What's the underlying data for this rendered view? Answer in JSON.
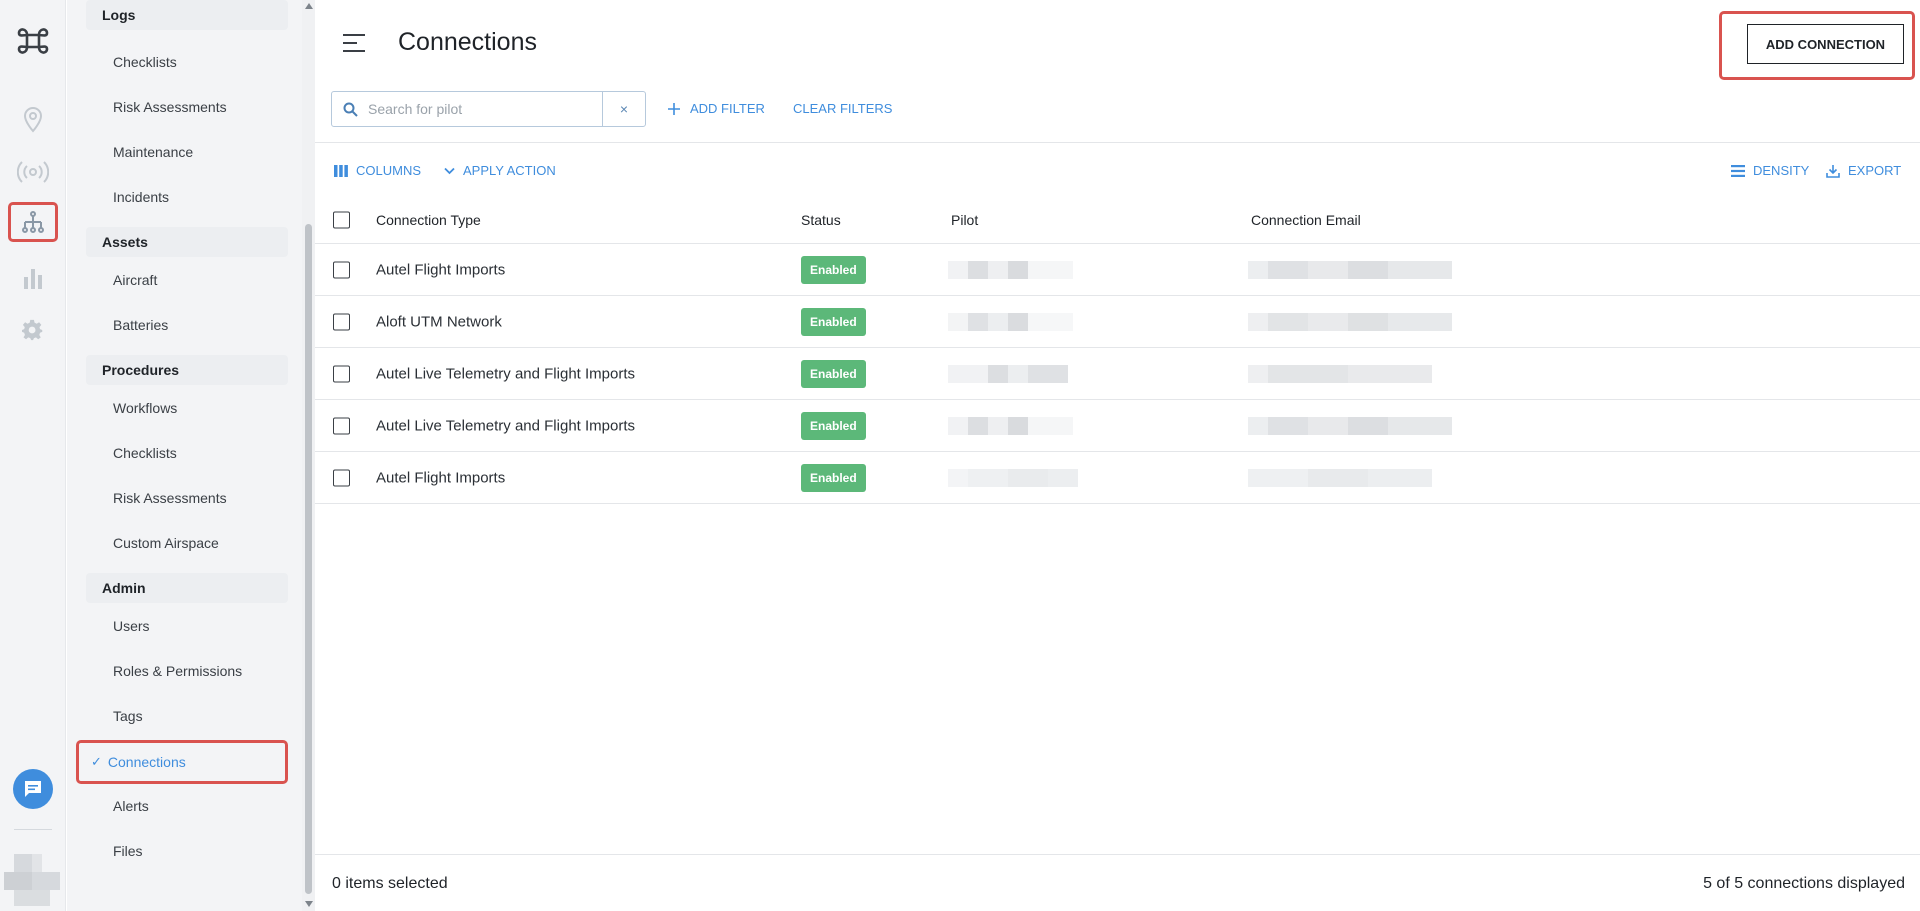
{
  "rail": {
    "items": [
      {
        "name": "map-pin-icon",
        "active": false
      },
      {
        "name": "broadcast-icon",
        "active": false
      },
      {
        "name": "org-chart-icon",
        "active": true
      },
      {
        "name": "bar-chart-icon",
        "active": false
      },
      {
        "name": "gear-icon",
        "active": false
      }
    ],
    "accent": "#3f8ddd"
  },
  "sidebar": {
    "sections": [
      {
        "title": "Logs",
        "items": [
          "Checklists",
          "Risk Assessments",
          "Maintenance",
          "Incidents"
        ]
      },
      {
        "title": "Assets",
        "items": [
          "Aircraft",
          "Batteries"
        ]
      },
      {
        "title": "Procedures",
        "items": [
          "Workflows",
          "Checklists",
          "Risk Assessments",
          "Custom Airspace"
        ]
      },
      {
        "title": "Admin",
        "items": [
          "Users",
          "Roles & Permissions",
          "Tags",
          "Connections",
          "Alerts",
          "Files"
        ]
      }
    ],
    "active_item": "Connections",
    "active_check": "✓"
  },
  "header": {
    "title": "Connections",
    "add_button": "ADD CONNECTION"
  },
  "filters": {
    "search_placeholder": "Search for pilot",
    "clear_symbol": "×",
    "add_filter": "ADD FILTER",
    "clear_filters": "CLEAR FILTERS"
  },
  "toolbar": {
    "columns": "COLUMNS",
    "apply_action": "APPLY ACTION",
    "density": "DENSITY",
    "export": "EXPORT"
  },
  "table": {
    "columns": [
      "Connection Type",
      "Status",
      "Pilot",
      "Connection Email"
    ],
    "rows": [
      {
        "type": "Autel Flight Imports",
        "status": "Enabled"
      },
      {
        "type": "Aloft UTM Network",
        "status": "Enabled"
      },
      {
        "type": "Autel Live Telemetry and Flight Imports",
        "status": "Enabled"
      },
      {
        "type": "Autel Live Telemetry and Flight Imports",
        "status": "Enabled"
      },
      {
        "type": "Autel Flight Imports",
        "status": "Enabled"
      }
    ],
    "status_color": "#5cb879"
  },
  "footer": {
    "selected": "0 items selected",
    "displayed": "5 of 5 connections displayed"
  }
}
